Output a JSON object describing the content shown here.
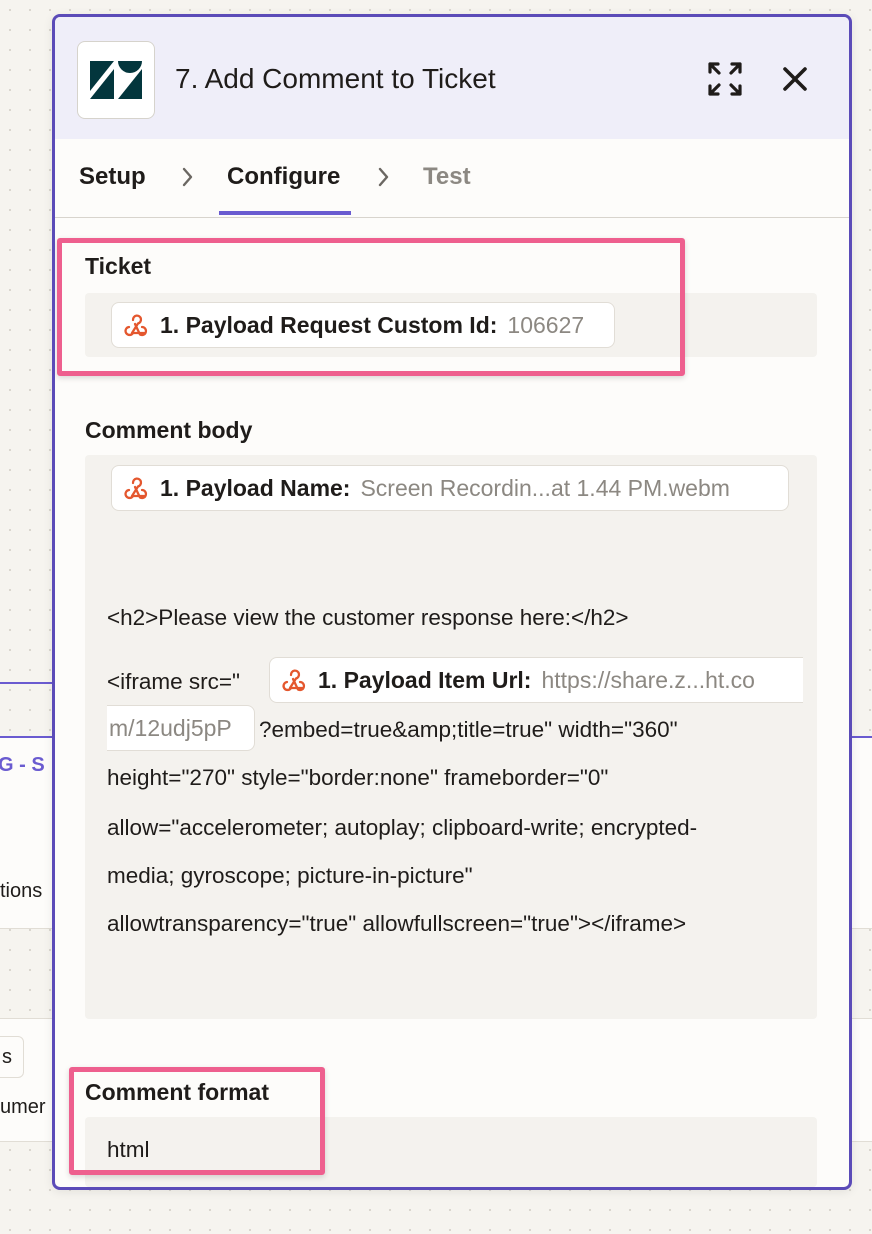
{
  "window": {
    "title": "7. Add Comment to Ticket",
    "app_icon": "zendesk-logo",
    "expand_icon": "expand-icon",
    "close_icon": "close-icon"
  },
  "tabs": [
    {
      "label": "Setup",
      "state": "complete"
    },
    {
      "label": "Configure",
      "state": "active"
    },
    {
      "label": "Test",
      "state": "inactive"
    }
  ],
  "ticket": {
    "label": "Ticket",
    "pill_key": "1. Payload Request Custom Id:",
    "pill_value": "106627"
  },
  "comment_body": {
    "label": "Comment body",
    "name_pill_key": "1. Payload Name:",
    "name_pill_value": "Screen Recordin...at 1.44 PM.webm",
    "line_h2": "<h2>Please view the customer response here:</h2>",
    "iframe_prefix": "<iframe src=\"",
    "url_pill_key": "1. Payload Item Url:",
    "url_pill_value_part1": "https://share.z...ht.co",
    "url_pill_value_part2": "m/12udj5pP",
    "line_after_url": "?embed=true&amp;title=true\" width=\"360\"",
    "line_3": "height=\"270\" style=\"border:none\" frameborder=\"0\"",
    "line_4": "allow=\"accelerometer; autoplay; clipboard-write; encrypted-",
    "line_5": "media; gyroscope; picture-in-picture\"",
    "line_6": "allowtransparency=\"true\" allowfullscreen=\"true\"></iframe>"
  },
  "comment_format": {
    "label": "Comment format",
    "value": "html"
  },
  "background": {
    "fragment_1": "G - S",
    "fragment_2": "tions",
    "fragment_3": "s",
    "fragment_4": "umer"
  },
  "colors": {
    "accent": "#6a5bd0",
    "panel_border": "#5b4bb8",
    "highlight": "#ee5f8e",
    "zendesk_brand": "#03363d",
    "webhook_icon": "#e4572e"
  }
}
